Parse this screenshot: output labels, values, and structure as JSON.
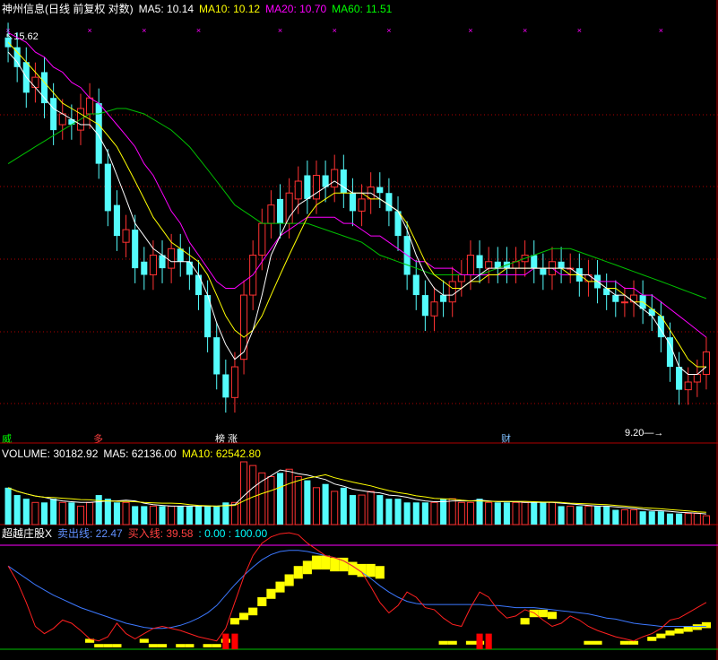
{
  "header": {
    "title": "神州信息(日线 前复权 对数)",
    "ma5": "MA5: 10.14",
    "ma10": "MA10: 10.12",
    "ma20": "MA20: 10.70",
    "ma60": "MA60: 11.51"
  },
  "price_labels": {
    "high": "15.62",
    "low": "9.20"
  },
  "event_marks": [
    {
      "text": "威",
      "color": "#00ff00"
    },
    {
      "text": "多",
      "color": "#ff4040"
    },
    {
      "text": "榜 涨",
      "color": "#ffffff"
    },
    {
      "text": "财",
      "color": "#80c0ff"
    }
  ],
  "volume_header": {
    "volume": "VOLUME: 30182.92",
    "ma5": "MA5: 62136.00",
    "ma10": "MA10: 62542.80"
  },
  "indicator_header": {
    "name": "超越庄股X",
    "sell": "卖出线: 22.47",
    "buy": "买入线: 39.58",
    "range": ": 0.00 : 100.00"
  },
  "colors": {
    "up": "#ff3232",
    "down": "#54fcfc",
    "ma5": "#ffffff",
    "ma10": "#ffff00",
    "ma20": "#ff00ff",
    "ma60": "#00c000",
    "sell_line": "#3c78ff",
    "buy_line": "#ff2020",
    "bar": "#ffff00",
    "bar_red": "#ff0000",
    "frame": "#b00000"
  },
  "chart_data": {
    "type": "candlestick",
    "scale": "log",
    "ylim": [
      9.2,
      15.62
    ],
    "close": [
      15.2,
      14.8,
      14.3,
      14.6,
      14.1,
      13.6,
      13.9,
      13.7,
      14.0,
      14.2,
      13.0,
      12.2,
      11.8,
      11.9,
      11.3,
      11.2,
      11.5,
      11.3,
      11.6,
      11.4,
      11.2,
      10.9,
      10.3,
      9.8,
      9.5,
      9.9,
      10.9,
      11.5,
      12.0,
      12.3,
      12.0,
      12.5,
      12.7,
      12.4,
      12.8,
      12.6,
      12.9,
      12.5,
      12.2,
      12.4,
      12.6,
      12.5,
      12.2,
      11.8,
      11.2,
      10.9,
      10.6,
      10.8,
      10.8,
      11.1,
      11.2,
      11.5,
      11.3,
      11.4,
      11.3,
      11.3,
      11.4,
      11.5,
      11.3,
      11.2,
      11.4,
      11.3,
      11.3,
      11.1,
      11.2,
      11.0,
      10.9,
      10.8,
      10.8,
      10.9,
      10.7,
      10.6,
      10.3,
      9.9,
      9.6,
      9.7,
      9.8,
      10.1
    ],
    "open": [
      15.4,
      15.2,
      14.9,
      14.4,
      14.7,
      14.2,
      13.7,
      13.8,
      13.6,
      13.9,
      14.1,
      13.0,
      12.3,
      11.7,
      11.9,
      11.4,
      11.2,
      11.5,
      11.3,
      11.6,
      11.4,
      11.2,
      10.9,
      10.3,
      9.8,
      9.5,
      10.0,
      10.9,
      11.5,
      12.0,
      12.4,
      12.0,
      12.4,
      12.8,
      12.4,
      12.8,
      12.6,
      12.9,
      12.5,
      12.2,
      12.4,
      12.6,
      12.5,
      12.2,
      11.8,
      11.2,
      10.9,
      10.6,
      10.9,
      10.8,
      11.1,
      11.2,
      11.5,
      11.3,
      11.4,
      11.4,
      11.3,
      11.4,
      11.5,
      11.3,
      11.2,
      11.4,
      11.3,
      11.3,
      11.1,
      11.2,
      11.0,
      10.9,
      10.8,
      10.8,
      10.9,
      10.7,
      10.6,
      10.3,
      9.9,
      9.6,
      9.7,
      9.8
    ],
    "ma5": [
      15.1,
      14.9,
      14.6,
      14.4,
      14.2,
      14.0,
      13.9,
      13.8,
      13.7,
      13.7,
      13.5,
      13.2,
      12.8,
      12.4,
      12.0,
      11.8,
      11.6,
      11.5,
      11.4,
      11.4,
      11.4,
      11.2,
      10.9,
      10.5,
      10.2,
      10.0,
      10.1,
      10.4,
      10.9,
      11.5,
      11.8,
      12.1,
      12.3,
      12.4,
      12.5,
      12.6,
      12.7,
      12.6,
      12.5,
      12.5,
      12.5,
      12.4,
      12.3,
      12.2,
      11.9,
      11.5,
      11.2,
      11.0,
      10.9,
      10.9,
      11.0,
      11.1,
      11.2,
      11.3,
      11.3,
      11.3,
      11.3,
      11.3,
      11.3,
      11.3,
      11.3,
      11.3,
      11.3,
      11.2,
      11.2,
      11.1,
      11.0,
      10.9,
      10.9,
      10.8,
      10.7,
      10.6,
      10.4,
      10.2,
      9.9,
      9.8,
      9.8,
      9.9
    ],
    "ma10": [
      15.3,
      15.1,
      14.9,
      14.7,
      14.5,
      14.3,
      14.1,
      14.0,
      13.9,
      13.8,
      13.7,
      13.5,
      13.3,
      13.0,
      12.7,
      12.4,
      12.1,
      11.9,
      11.7,
      11.6,
      11.5,
      11.4,
      11.2,
      10.9,
      10.6,
      10.4,
      10.3,
      10.4,
      10.6,
      10.9,
      11.2,
      11.5,
      11.8,
      12.1,
      12.3,
      12.4,
      12.5,
      12.5,
      12.5,
      12.5,
      12.4,
      12.4,
      12.3,
      12.2,
      12.0,
      11.7,
      11.4,
      11.2,
      11.1,
      11.0,
      11.0,
      11.1,
      11.1,
      11.2,
      11.2,
      11.3,
      11.3,
      11.3,
      11.3,
      11.3,
      11.3,
      11.3,
      11.2,
      11.2,
      11.1,
      11.1,
      11.0,
      11.0,
      10.9,
      10.8,
      10.8,
      10.7,
      10.6,
      10.4,
      10.2,
      10.0,
      9.9,
      9.9
    ],
    "ma20": [
      15.5,
      15.4,
      15.3,
      15.1,
      15.0,
      14.8,
      14.7,
      14.5,
      14.4,
      14.2,
      14.1,
      13.9,
      13.7,
      13.5,
      13.3,
      13.0,
      12.8,
      12.5,
      12.2,
      12.0,
      11.7,
      11.5,
      11.3,
      11.1,
      11.0,
      11.0,
      11.1,
      11.2,
      11.4,
      11.6,
      11.8,
      11.9,
      12.0,
      12.1,
      12.1,
      12.1,
      12.1,
      12.0,
      12.0,
      11.9,
      11.8,
      11.8,
      11.7,
      11.6,
      11.5,
      11.4,
      11.4,
      11.3,
      11.3,
      11.3,
      11.2,
      11.2,
      11.2,
      11.2,
      11.2,
      11.2,
      11.2,
      11.2,
      11.3,
      11.3,
      11.3,
      11.2,
      11.2,
      11.2,
      11.2,
      11.1,
      11.1,
      11.1,
      11.0,
      11.0,
      10.9,
      10.9,
      10.8,
      10.7,
      10.6,
      10.5,
      10.4,
      10.3
    ],
    "ma60": [
      13.0,
      13.1,
      13.2,
      13.3,
      13.4,
      13.5,
      13.6,
      13.7,
      13.8,
      13.9,
      13.9,
      13.95,
      14.0,
      14.0,
      13.95,
      13.9,
      13.8,
      13.7,
      13.6,
      13.45,
      13.3,
      13.1,
      12.9,
      12.7,
      12.5,
      12.3,
      12.2,
      12.1,
      12.0,
      12.0,
      12.0,
      12.0,
      12.0,
      12.0,
      11.95,
      11.9,
      11.85,
      11.8,
      11.75,
      11.7,
      11.6,
      11.5,
      11.45,
      11.4,
      11.35,
      11.3,
      11.25,
      11.2,
      11.2,
      11.2,
      11.2,
      11.2,
      11.2,
      11.25,
      11.3,
      11.35,
      11.4,
      11.45,
      11.5,
      11.55,
      11.6,
      11.6,
      11.6,
      11.55,
      11.5,
      11.45,
      11.4,
      11.35,
      11.3,
      11.25,
      11.2,
      11.15,
      11.1,
      11.05,
      11.0,
      10.95,
      10.9,
      10.85
    ],
    "volume": [
      5,
      4,
      3.5,
      3,
      3,
      3.5,
      3,
      3,
      2.5,
      3,
      4,
      3.5,
      3,
      3,
      2.5,
      2.5,
      2.5,
      2.5,
      2.5,
      2.5,
      2.5,
      2.5,
      2.5,
      2.5,
      3,
      3,
      8.5,
      8,
      7,
      6.5,
      7,
      7.5,
      6.5,
      6,
      5,
      5.5,
      4.5,
      5,
      4,
      4,
      4.5,
      4,
      3.5,
      3.5,
      3,
      3,
      3,
      3,
      3.5,
      3.5,
      3,
      3,
      3.5,
      3,
      3,
      3,
      3,
      3,
      3,
      3,
      3,
      2.5,
      2.5,
      2.5,
      2.5,
      2.5,
      2.5,
      2,
      2,
      2,
      1.8,
      1.8,
      1.8,
      1.5,
      1.5,
      1.5,
      1.5,
      1.2
    ],
    "sell_line": [
      80,
      74,
      68,
      62,
      57,
      52,
      48,
      44,
      40,
      37,
      34,
      31,
      28,
      25,
      23,
      21,
      20,
      20,
      21,
      23,
      26,
      30,
      35,
      42,
      52,
      62,
      71,
      79,
      86,
      91,
      94,
      95,
      95,
      94,
      92,
      90,
      88,
      85,
      80,
      74,
      68,
      61,
      55,
      50,
      46,
      44,
      43,
      43,
      43,
      43,
      43,
      43,
      43,
      42,
      42,
      41,
      40,
      40,
      40,
      39,
      38,
      37,
      36,
      35,
      34,
      32,
      30,
      29,
      27,
      25,
      24,
      23,
      22,
      22,
      22,
      22,
      22,
      22
    ],
    "buy_line": [
      80,
      65,
      45,
      22,
      15,
      20,
      28,
      25,
      18,
      10,
      8,
      12,
      25,
      15,
      10,
      15,
      20,
      22,
      20,
      18,
      15,
      12,
      10,
      8,
      20,
      45,
      70,
      90,
      102,
      108,
      111,
      112,
      110,
      102,
      96,
      90,
      88,
      85,
      80,
      74,
      60,
      45,
      35,
      42,
      55,
      50,
      40,
      38,
      30,
      24,
      22,
      40,
      55,
      50,
      38,
      30,
      32,
      38,
      35,
      28,
      22,
      25,
      32,
      28,
      22,
      18,
      15,
      12,
      10,
      8,
      12,
      15,
      20,
      28,
      30,
      35,
      40,
      45
    ],
    "bar_value": [
      0,
      0,
      0,
      0,
      0,
      0,
      0,
      0,
      0,
      10,
      5,
      5,
      5,
      0,
      0,
      10,
      5,
      5,
      0,
      5,
      5,
      0,
      5,
      5,
      10,
      30,
      35,
      40,
      50,
      58,
      65,
      72,
      80,
      85,
      90,
      90,
      88,
      88,
      84,
      82,
      82,
      80,
      0,
      0,
      0,
      0,
      0,
      0,
      8,
      8,
      0,
      8,
      8,
      0,
      0,
      0,
      0,
      30,
      38,
      38,
      36,
      0,
      0,
      0,
      8,
      8,
      0,
      0,
      8,
      8,
      0,
      12,
      15,
      18,
      20,
      22,
      24,
      26
    ],
    "bar_red_value": [
      0,
      0,
      0,
      0,
      0,
      0,
      0,
      0,
      0,
      0,
      0,
      0,
      0,
      0,
      0,
      0,
      0,
      0,
      0,
      0,
      0,
      0,
      0,
      0,
      15,
      15,
      0,
      0,
      0,
      0,
      0,
      0,
      0,
      0,
      0,
      0,
      0,
      0,
      0,
      0,
      0,
      0,
      0,
      0,
      0,
      0,
      0,
      0,
      0,
      0,
      0,
      0,
      15,
      15,
      0,
      0,
      0,
      0,
      0,
      0,
      0,
      0,
      0,
      0,
      0,
      0,
      0,
      0,
      0,
      0,
      0,
      0,
      0,
      0,
      0,
      0,
      0,
      0
    ],
    "indicator_ylim": [
      0,
      100
    ]
  }
}
